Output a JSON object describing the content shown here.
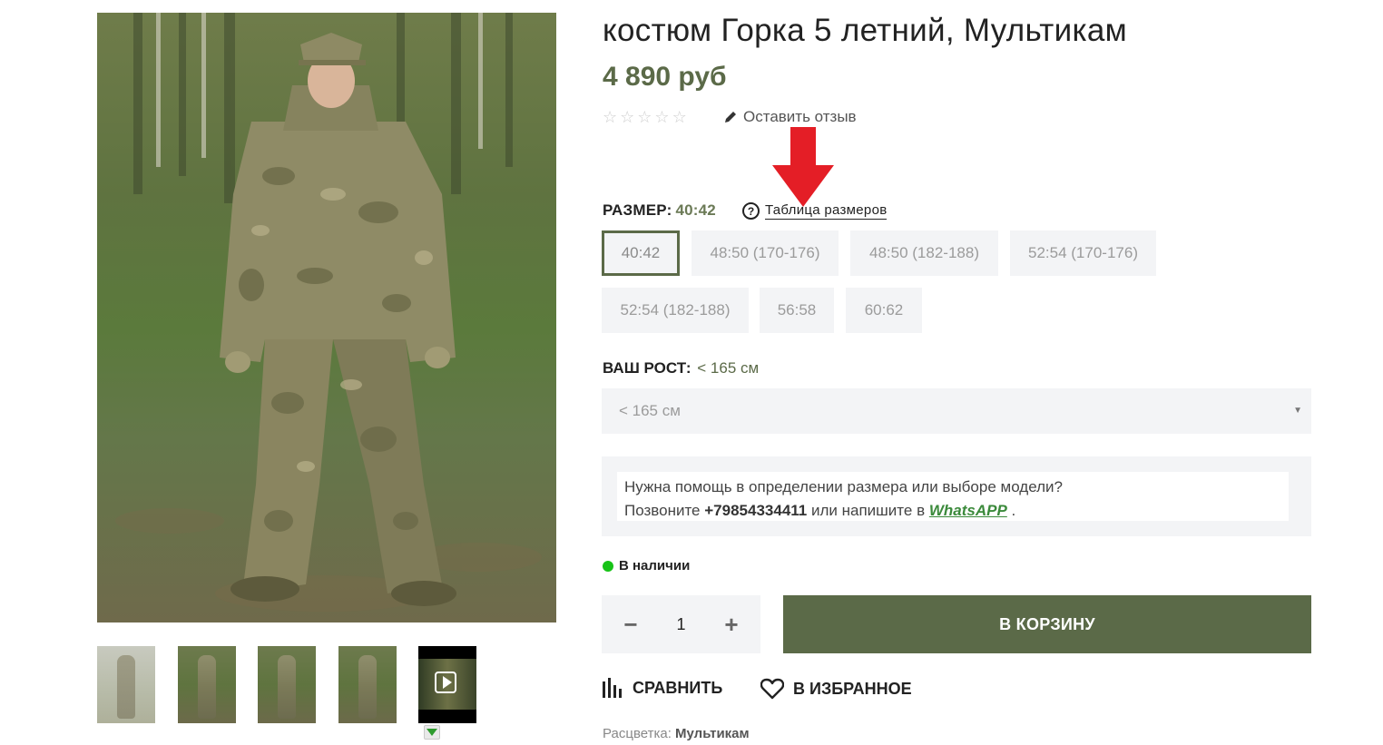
{
  "product": {
    "title": "костюм Горка 5 летний, Мультикам",
    "price": "4 890 руб",
    "rating_stars": 0,
    "review_link": "Оставить отзыв"
  },
  "gallery": {
    "main_photo_icon": "product-photo-soldier-camo",
    "thumbnails": [
      {
        "icon": "photo-thumbnail"
      },
      {
        "icon": "photo-thumbnail"
      },
      {
        "icon": "photo-thumbnail"
      },
      {
        "icon": "photo-thumbnail"
      },
      {
        "icon": "video-thumbnail"
      }
    ]
  },
  "size": {
    "label": "РАЗМЕР:",
    "selected": "40:42",
    "table_link": "Таблица размеров",
    "options": [
      "40:42",
      "48:50 (170-176)",
      "48:50 (182-188)",
      "52:54 (170-176)",
      "52:54 (182-188)",
      "56:58",
      "60:62"
    ]
  },
  "height": {
    "label": "ВАШ РОСТ:",
    "selected": "< 165 см",
    "select_value": "< 165 см"
  },
  "help": {
    "line1": "Нужна помощь в определении размера или выборе модели?",
    "line2_prefix": "Позвоните",
    "phone": "+79854334411",
    "line2_middle": "или напишите в",
    "whatsapp": "WhatsAPP",
    "line2_suffix": "."
  },
  "stock": {
    "text": "В наличии",
    "color": "#18c318"
  },
  "cart": {
    "quantity": "1",
    "minus": "−",
    "plus": "+",
    "button": "В КОРЗИНУ"
  },
  "actions": {
    "compare": "СРАВНИТЬ",
    "favorite": "В ИЗБРАННОЕ"
  },
  "color": {
    "label": "Расцветка:",
    "value": "Мультикам"
  },
  "theme": {
    "accent": "#5b6a48",
    "arrow": "#e41e26"
  }
}
